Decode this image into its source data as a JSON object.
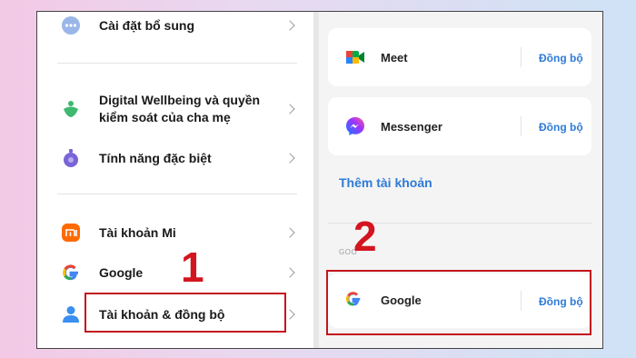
{
  "settings_list": {
    "items": [
      {
        "label": "Cài đặt bổ sung",
        "icon": "dots-icon"
      },
      {
        "label_line1": "Digital Wellbeing và quyền",
        "label_line2": "kiểm soát của cha mẹ",
        "icon": "wellbeing-icon"
      },
      {
        "label": "Tính năng đặc biệt",
        "icon": "special-features-icon"
      },
      {
        "label": "Tài khoản Mi",
        "icon": "mi-icon"
      },
      {
        "label": "Google",
        "icon": "google-icon"
      },
      {
        "label": "Tài khoản & đồng bộ",
        "icon": "account-icon"
      }
    ]
  },
  "accounts_panel": {
    "cards": [
      {
        "name": "Meet",
        "action": "Đồng bộ",
        "icon": "meet-icon"
      },
      {
        "name": "Messenger",
        "action": "Đồng bộ",
        "icon": "messenger-icon"
      }
    ],
    "add_account": "Thêm tài khoản",
    "section_label": "GOO",
    "google_card": {
      "name": "Google",
      "action": "Đồng bộ",
      "icon": "google-icon"
    }
  },
  "annotations": {
    "step1": "1",
    "step2": "2"
  },
  "colors": {
    "accent_blue": "#2f7bd6",
    "highlight_red": "#c3141e"
  }
}
